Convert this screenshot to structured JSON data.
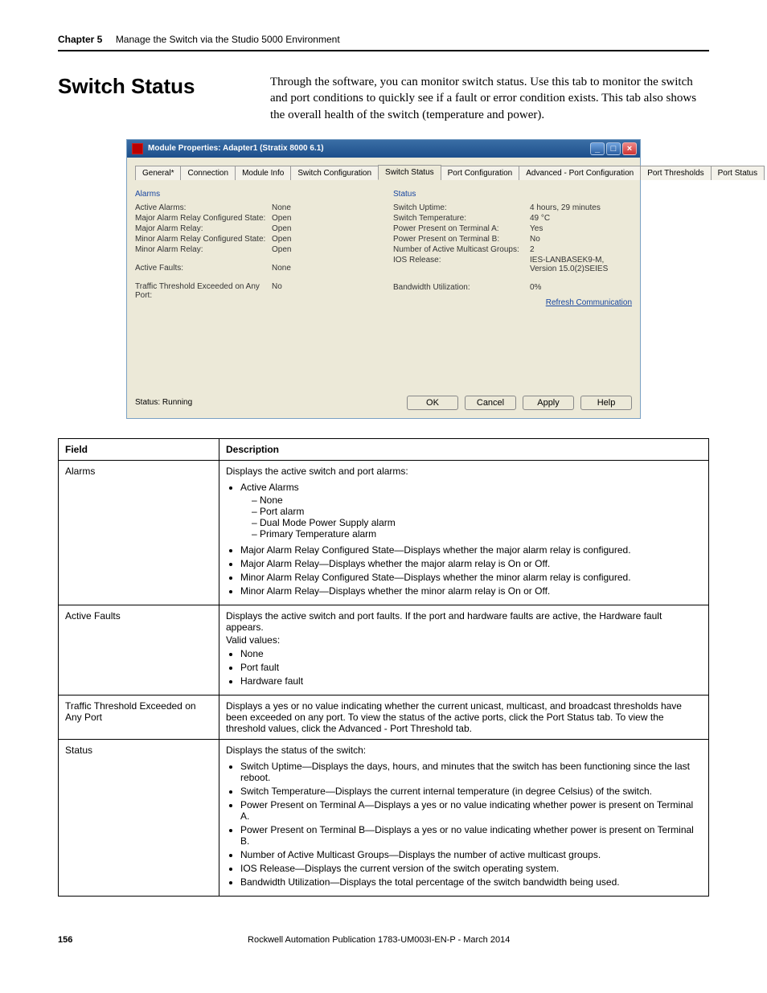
{
  "chapter": {
    "label": "Chapter 5",
    "title": "Manage the Switch via the Studio 5000 Environment"
  },
  "section": {
    "heading": "Switch Status"
  },
  "intro": "Through the software, you can monitor switch status. Use this tab to monitor the switch and port conditions to quickly see if a fault or error condition exists. This tab also shows the overall health of the switch (temperature and power).",
  "window": {
    "title": "Module Properties: Adapter1 (Stratix 8000 6.1)",
    "tabs": [
      "General*",
      "Connection",
      "Module Info",
      "Switch Configuration",
      "Switch Status",
      "Port Configuration",
      "Advanced - Port Configuration",
      "Port Thresholds",
      "Port Status"
    ],
    "active_tab": 4,
    "alarms_header": "Alarms",
    "status_header": "Status",
    "alarms": [
      {
        "k": "Active Alarms:",
        "v": "None"
      },
      {
        "k": "Major Alarm Relay Configured State:",
        "v": "Open"
      },
      {
        "k": "Major Alarm Relay:",
        "v": "Open"
      },
      {
        "k": "Minor Alarm Relay Configured State:",
        "v": "Open"
      },
      {
        "k": "Minor Alarm Relay:",
        "v": "Open"
      }
    ],
    "active_faults": {
      "k": "Active Faults:",
      "v": "None"
    },
    "traffic": {
      "k": "Traffic Threshold Exceeded on Any Port:",
      "v": "No"
    },
    "status": [
      {
        "k": "Switch Uptime:",
        "v": "4 hours, 29 minutes"
      },
      {
        "k": "Switch Temperature:",
        "v": "49 °C"
      },
      {
        "k": "Power Present on Terminal A:",
        "v": "Yes"
      },
      {
        "k": "Power Present on Terminal B:",
        "v": "No"
      },
      {
        "k": "Number of Active Multicast Groups:",
        "v": "2"
      },
      {
        "k": "IOS Release:",
        "v": "IES-LANBASEK9-M, Version 15.0(2)SEIES"
      }
    ],
    "bandwidth": {
      "k": "Bandwidth Utilization:",
      "v": "0%"
    },
    "refresh": "Refresh Communication",
    "status_label": "Status:  Running",
    "buttons": {
      "ok": "OK",
      "cancel": "Cancel",
      "apply": "Apply",
      "help": "Help"
    }
  },
  "table": {
    "head_field": "Field",
    "head_desc": "Description",
    "rows": [
      {
        "field": "Alarms",
        "lead": "Displays the active switch and port alarms:",
        "active_alarms_label": "Active Alarms",
        "active_alarms_vals": [
          "None",
          "Port alarm",
          "Dual Mode Power Supply alarm",
          "Primary Temperature alarm"
        ],
        "bullets": [
          "Major Alarm Relay Configured State—Displays whether the major alarm relay is configured.",
          "Major Alarm Relay—Displays whether the major alarm relay is On or Off.",
          "Minor Alarm Relay Configured State—Displays whether the minor alarm relay is configured.",
          "Minor Alarm Relay—Displays whether the minor alarm relay is On or Off."
        ]
      },
      {
        "field": "Active Faults",
        "lead": "Displays the active switch and port faults. If the port and hardware faults are active, the Hardware fault appears.",
        "valid_label": "Valid values:",
        "valid": [
          "None",
          "Port fault",
          "Hardware fault"
        ]
      },
      {
        "field": "Traffic Threshold Exceeded on Any Port",
        "lead": "Displays a yes or no value indicating whether the current unicast, multicast, and broadcast thresholds have been exceeded on any port. To view the status of the active ports, click the Port Status tab. To view the threshold values, click the Advanced - Port Threshold tab."
      },
      {
        "field": "Status",
        "lead": "Displays the status of the switch:",
        "bullets": [
          "Switch Uptime—Displays the days, hours, and minutes that the switch has been functioning since the last reboot.",
          "Switch Temperature—Displays the current internal temperature (in degree Celsius) of the switch.",
          "Power Present on Terminal A—Displays a yes or no value indicating whether power is present on Terminal A.",
          "Power Present on Terminal B—Displays a yes or no value indicating whether power is present on Terminal B.",
          "Number of Active Multicast Groups—Displays the number of active multicast groups.",
          "IOS Release—Displays the current version of the switch operating system.",
          "Bandwidth Utilization—Displays the total percentage of the switch bandwidth being used."
        ]
      }
    ]
  },
  "footer": {
    "page": "156",
    "pub": "Rockwell Automation Publication 1783-UM003I-EN-P - March 2014"
  }
}
